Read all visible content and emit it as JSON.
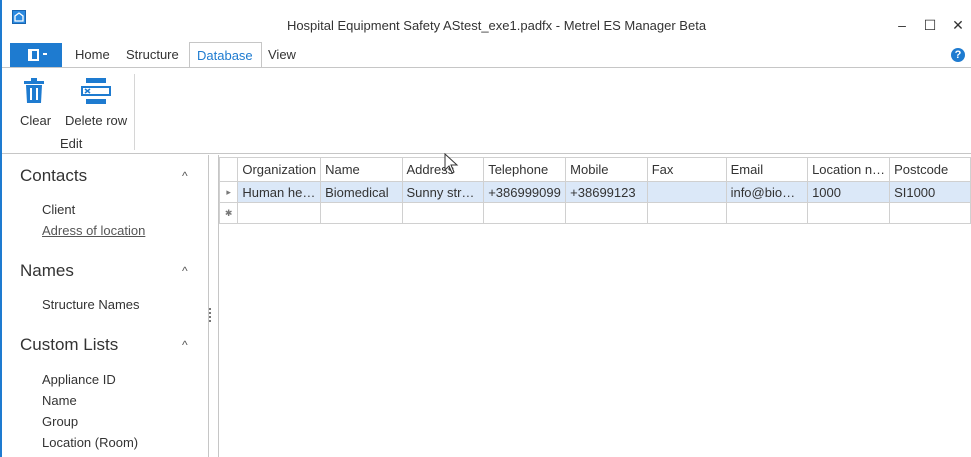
{
  "window": {
    "title": "Hospital Equipment Safety AStest_exe1.padfx - Metrel ES Manager Beta",
    "controls": {
      "minimize": "–",
      "maximize": "☐",
      "close": "✕"
    }
  },
  "menu": {
    "tabs": [
      "Home",
      "Structure",
      "Database",
      "View"
    ],
    "active_tab": "Database",
    "help": "?"
  },
  "ribbon": {
    "buttons": [
      {
        "label": "Clear",
        "icon": "trash-icon"
      },
      {
        "label": "Delete row",
        "icon": "delete-row-icon"
      }
    ],
    "group_label": "Edit"
  },
  "sidebar": {
    "sections": [
      {
        "title": "Contacts",
        "items": [
          "Client",
          "Adress of location"
        ]
      },
      {
        "title": "Names",
        "items": [
          "Structure Names"
        ]
      },
      {
        "title": "Custom Lists",
        "items": [
          "Appliance ID",
          "Name",
          "Group",
          "Location (Room)"
        ]
      }
    ],
    "collapse_glyph": "^"
  },
  "grid": {
    "columns": [
      "Organization",
      "Name",
      "Address",
      "Telephone",
      "Mobile",
      "Fax",
      "Email",
      "Location n…",
      "Postcode"
    ],
    "rows": [
      [
        "Human he…",
        "Biomedical",
        "Sunny str…",
        "+386999099",
        "+38699123",
        "",
        "info@bio…",
        "1000",
        "SI1000"
      ]
    ],
    "row_marker": "▸",
    "new_row_marker": "✱"
  },
  "colors": {
    "accent": "#1e7bd0",
    "selected_row": "#dbe8f8"
  }
}
